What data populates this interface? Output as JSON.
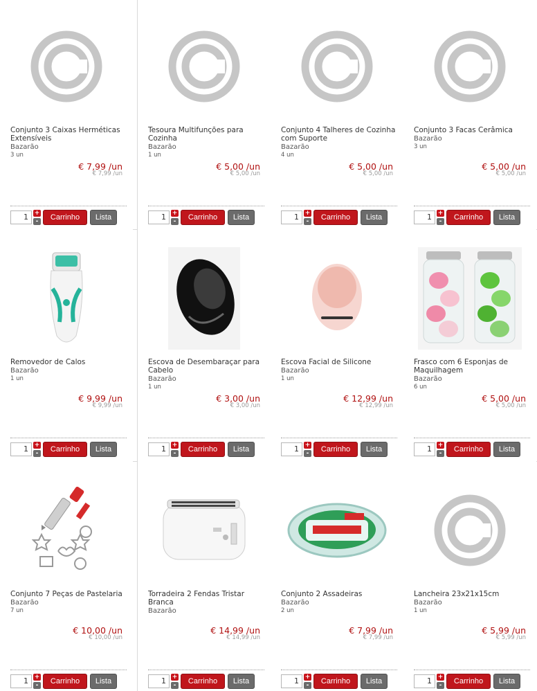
{
  "buttons": {
    "cart": "Carrinho",
    "list": "Lista"
  },
  "stepper": {
    "plus": "+",
    "minus": "-"
  },
  "products": [
    {
      "name": "Conjunto 3 Caixas Herméticas Extensíveis",
      "brand": "Bazarão",
      "unit": "3 un",
      "price": "€ 7,99 /un",
      "price_sub": "€ 7,99 /un",
      "qty": "1",
      "image": "copyright-placeholder-icon"
    },
    {
      "name": "Tesoura Multifunções para Cozinha",
      "brand": "Bazarão",
      "unit": "1 un",
      "price": "€ 5,00 /un",
      "price_sub": "€ 5,00 /un",
      "qty": "1",
      "image": "copyright-placeholder-icon"
    },
    {
      "name": "Conjunto 4 Talheres de Cozinha com Suporte",
      "brand": "Bazarão",
      "unit": "4 un",
      "price": "€ 5,00 /un",
      "price_sub": "€ 5,00 /un",
      "qty": "1",
      "image": "copyright-placeholder-icon"
    },
    {
      "name": "Conjunto 3 Facas Cerâmica",
      "brand": "Bazarão",
      "unit": "3 un",
      "price": "€ 5,00 /un",
      "price_sub": "€ 5,00 /un",
      "qty": "1",
      "image": "copyright-placeholder-icon"
    },
    {
      "name": "Removedor de Calos",
      "brand": "Bazarão",
      "unit": "1 un",
      "price": "€ 9,99 /un",
      "price_sub": "€ 9,99 /un",
      "qty": "1",
      "image": "callus-remover-image"
    },
    {
      "name": "Escova de Desembaraçar para Cabelo",
      "brand": "Bazarão",
      "unit": "1 un",
      "price": "€ 3,00 /un",
      "price_sub": "€ 3,00 /un",
      "qty": "1",
      "image": "detangling-brush-image"
    },
    {
      "name": "Escova Facial de Silicone",
      "brand": "Bazarão",
      "unit": "1 un",
      "price": "€ 12,99 /un",
      "price_sub": "€ 12,99 /un",
      "qty": "1",
      "image": "facial-brush-image"
    },
    {
      "name": "Frasco com 6 Esponjas de Maquilhagem",
      "brand": "Bazarão",
      "unit": "6 un",
      "price": "€ 5,00 /un",
      "price_sub": "€ 5,00 /un",
      "qty": "1",
      "image": "makeup-sponges-image"
    },
    {
      "name": "Conjunto 7 Peças de Pastelaria",
      "brand": "Bazarão",
      "unit": "7 un",
      "price": "€ 10,00 /un",
      "price_sub": "€ 10,00 /un",
      "qty": "1",
      "image": "pastry-set-image"
    },
    {
      "name": "Torradeira 2 Fendas Tristar Branca",
      "brand": "Bazarão",
      "unit": "",
      "price": "€ 14,99 /un",
      "price_sub": "€ 14,99 /un",
      "qty": "1",
      "image": "toaster-image"
    },
    {
      "name": "Conjunto 2 Assadeiras",
      "brand": "Bazarão",
      "unit": "2 un",
      "price": "€ 7,99 /un",
      "price_sub": "€ 7,99 /un",
      "qty": "1",
      "image": "oven-dish-image"
    },
    {
      "name": "Lancheira 23x21x15cm",
      "brand": "Bazarão",
      "unit": "1 un",
      "price": "€ 5,99 /un",
      "price_sub": "€ 5,99 /un",
      "qty": "1",
      "image": "copyright-placeholder-icon"
    }
  ]
}
